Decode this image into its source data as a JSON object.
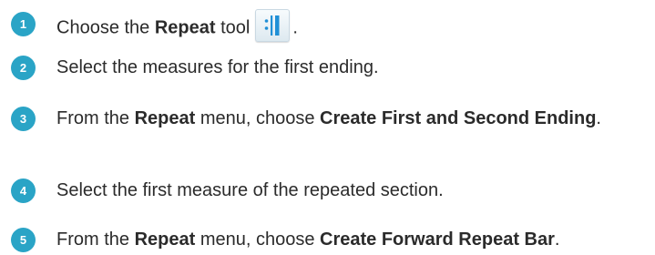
{
  "steps": [
    {
      "number": "1",
      "parts": [
        "Choose the ",
        "Repeat",
        " tool",
        "."
      ]
    },
    {
      "number": "2",
      "text": "Select the measures for the first ending."
    },
    {
      "number": "3",
      "parts": [
        "From the ",
        "Repeat",
        " menu, choose ",
        "Create First and Second Ending",
        "."
      ]
    },
    {
      "number": "4",
      "text": "Select the first measure of the repeated section."
    },
    {
      "number": "5",
      "parts": [
        "From the ",
        "Repeat",
        " menu, choose ",
        "Create Forward Repeat Bar",
        "."
      ]
    }
  ],
  "icons": {
    "repeat_tool": "repeat-tool-icon"
  },
  "colors": {
    "badge": "#2aa4c6",
    "text": "#2b2b2b",
    "icon_accent": "#1f8fd6"
  }
}
